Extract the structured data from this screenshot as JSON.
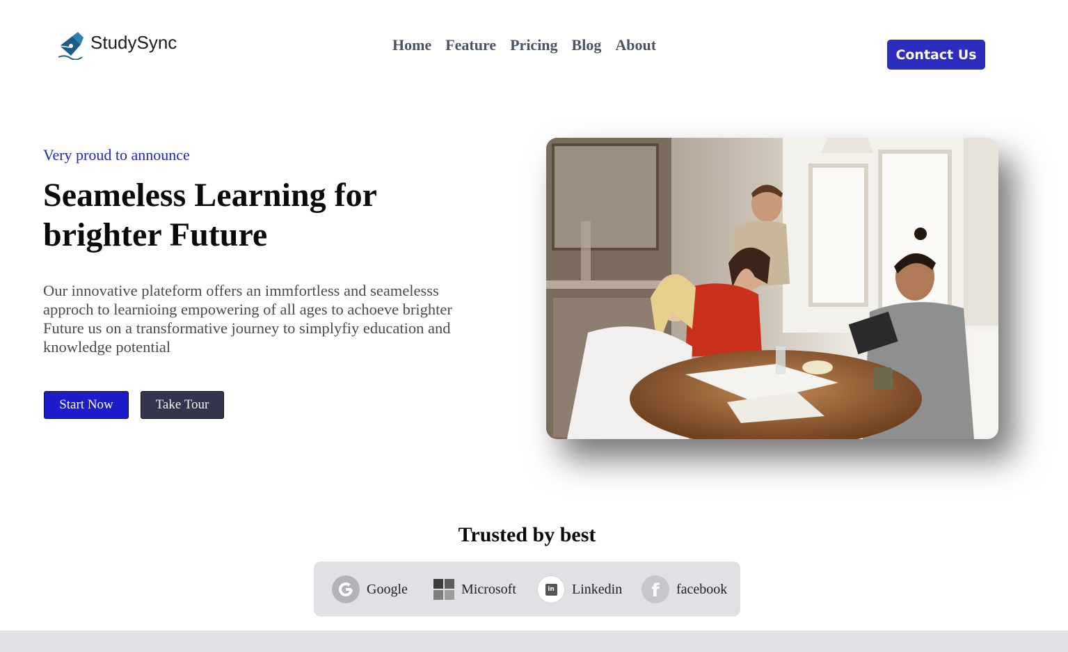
{
  "brand": {
    "name": "StudySync",
    "icon": "pen-nib-logo-icon"
  },
  "nav": {
    "items": [
      {
        "label": "Home"
      },
      {
        "label": "Feature"
      },
      {
        "label": "Pricing"
      },
      {
        "label": "Blog"
      },
      {
        "label": "About"
      }
    ]
  },
  "header": {
    "contact_label": "Contact Us"
  },
  "hero": {
    "eyebrow": "Very proud to announce",
    "headline_line1": "Seameless Learning for",
    "headline_line2": "brighter Future",
    "description": "Our innovative plateform offers an immfortless and seamelesss approch to learnioing empowering of all ages to achoeve brighter Future us on a transformative journey to simplyfiy education and knowledge potential",
    "start_label": "Start Now",
    "tour_label": "Take Tour",
    "image_icon": "students-studying-photo"
  },
  "trusted": {
    "title": "Trusted by best",
    "brands": [
      {
        "label": "Google",
        "icon": "google-icon"
      },
      {
        "label": "Microsoft",
        "icon": "microsoft-icon"
      },
      {
        "label": "Linkedin",
        "icon": "linkedin-icon"
      },
      {
        "label": "facebook",
        "icon": "facebook-icon"
      }
    ]
  },
  "colors": {
    "accent": "#2c2cbe",
    "eyebrow": "#2323c8",
    "nav_text": "#4b5363",
    "tour_button": "#34344c",
    "trusted_bar": "#e1e1e5"
  }
}
